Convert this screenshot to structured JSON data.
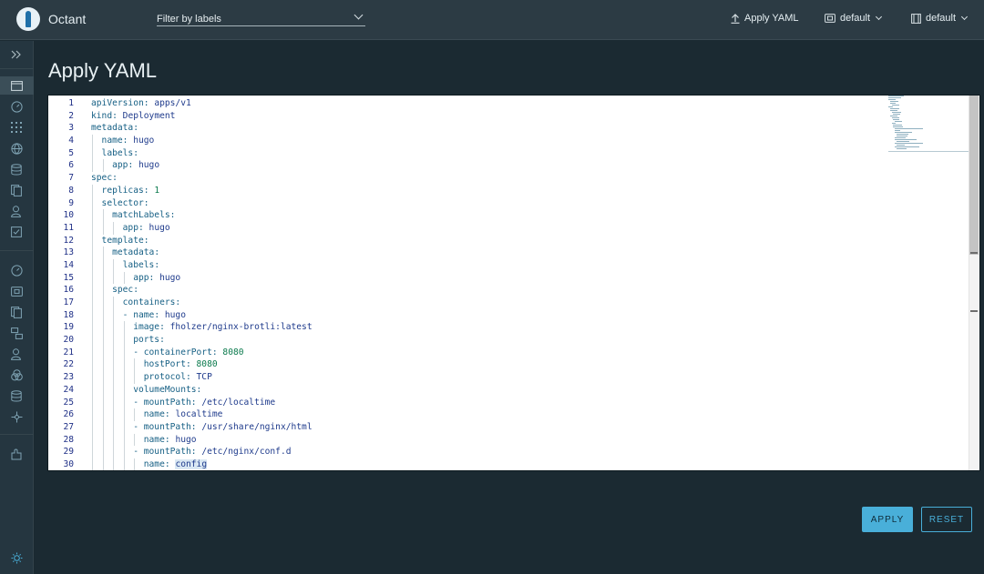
{
  "app": {
    "name": "Octant"
  },
  "header": {
    "filter_placeholder": "Filter by labels",
    "apply_yaml_label": "Apply YAML",
    "namespace_label": "default",
    "context_label": "default"
  },
  "sidebar": {
    "items": [
      "expand-icon",
      "overview-icon",
      "dashboard-icon",
      "workloads-grid-icon",
      "network-globe-icon",
      "storage-icon",
      "config-files-icon",
      "rbac-user-icon",
      "events-icon",
      "cluster-dashboard-icon",
      "namespaces-icon",
      "custom-resources-icon",
      "nodes-icon",
      "roles-icon",
      "port-forward-icon",
      "storage-classes-icon",
      "api-icon",
      "plugin-icon",
      "theme-toggle-icon"
    ]
  },
  "page": {
    "title": "Apply YAML"
  },
  "editor": {
    "lines": [
      {
        "no": "1",
        "key": "apiVersion",
        "sep": ": ",
        "val": "apps/v1",
        "vtype": "v"
      },
      {
        "no": "2",
        "key": "kind",
        "sep": ": ",
        "val": "Deployment",
        "vtype": "v"
      },
      {
        "no": "3",
        "key": "metadata",
        "sep": ":",
        "val": "",
        "vtype": "v"
      },
      {
        "no": "4",
        "key": "  name",
        "sep": ": ",
        "val": "hugo",
        "vtype": "v"
      },
      {
        "no": "5",
        "key": "  labels",
        "sep": ":",
        "val": "",
        "vtype": "v"
      },
      {
        "no": "6",
        "key": "    app",
        "sep": ": ",
        "val": "hugo",
        "vtype": "v"
      },
      {
        "no": "7",
        "key": "spec",
        "sep": ":",
        "val": "",
        "vtype": "v"
      },
      {
        "no": "8",
        "key": "  replicas",
        "sep": ": ",
        "val": "1",
        "vtype": "n"
      },
      {
        "no": "9",
        "key": "  selector",
        "sep": ":",
        "val": "",
        "vtype": "v"
      },
      {
        "no": "10",
        "key": "    matchLabels",
        "sep": ":",
        "val": "",
        "vtype": "v"
      },
      {
        "no": "11",
        "key": "      app",
        "sep": ": ",
        "val": "hugo",
        "vtype": "v"
      },
      {
        "no": "12",
        "key": "  template",
        "sep": ":",
        "val": "",
        "vtype": "v"
      },
      {
        "no": "13",
        "key": "    metadata",
        "sep": ":",
        "val": "",
        "vtype": "v"
      },
      {
        "no": "14",
        "key": "      labels",
        "sep": ":",
        "val": "",
        "vtype": "v"
      },
      {
        "no": "15",
        "key": "        app",
        "sep": ": ",
        "val": "hugo",
        "vtype": "v"
      },
      {
        "no": "16",
        "key": "    spec",
        "sep": ":",
        "val": "",
        "vtype": "v"
      },
      {
        "no": "17",
        "key": "      containers",
        "sep": ":",
        "val": "",
        "vtype": "v"
      },
      {
        "no": "18",
        "key": "      - name",
        "sep": ": ",
        "val": "hugo",
        "vtype": "v"
      },
      {
        "no": "19",
        "key": "        image",
        "sep": ": ",
        "val": "fholzer/nginx-brotli:latest",
        "vtype": "v"
      },
      {
        "no": "20",
        "key": "        ports",
        "sep": ":",
        "val": "",
        "vtype": "v"
      },
      {
        "no": "21",
        "key": "        - containerPort",
        "sep": ": ",
        "val": "8080",
        "vtype": "n"
      },
      {
        "no": "22",
        "key": "          hostPort",
        "sep": ": ",
        "val": "8080",
        "vtype": "n"
      },
      {
        "no": "23",
        "key": "          protocol",
        "sep": ": ",
        "val": "TCP",
        "vtype": "v"
      },
      {
        "no": "24",
        "key": "        volumeMounts",
        "sep": ":",
        "val": "",
        "vtype": "v"
      },
      {
        "no": "25",
        "key": "        - mountPath",
        "sep": ": ",
        "val": "/etc/localtime",
        "vtype": "v"
      },
      {
        "no": "26",
        "key": "          name",
        "sep": ": ",
        "val": "localtime",
        "vtype": "v"
      },
      {
        "no": "27",
        "key": "        - mountPath",
        "sep": ": ",
        "val": "/usr/share/nginx/html",
        "vtype": "v"
      },
      {
        "no": "28",
        "key": "          name",
        "sep": ": ",
        "val": "hugo",
        "vtype": "v"
      },
      {
        "no": "29",
        "key": "        - mountPath",
        "sep": ": ",
        "val": "/etc/nginx/conf.d",
        "vtype": "v"
      },
      {
        "no": "30",
        "key": "          name",
        "sep": ": ",
        "val": "config",
        "vtype": "v",
        "highlight": true
      }
    ]
  },
  "actions": {
    "apply_label": "APPLY",
    "reset_label": "RESET"
  },
  "colors": {
    "accent": "#49afd9",
    "background": "#1b2a32",
    "topbar": "#2c3b44"
  }
}
